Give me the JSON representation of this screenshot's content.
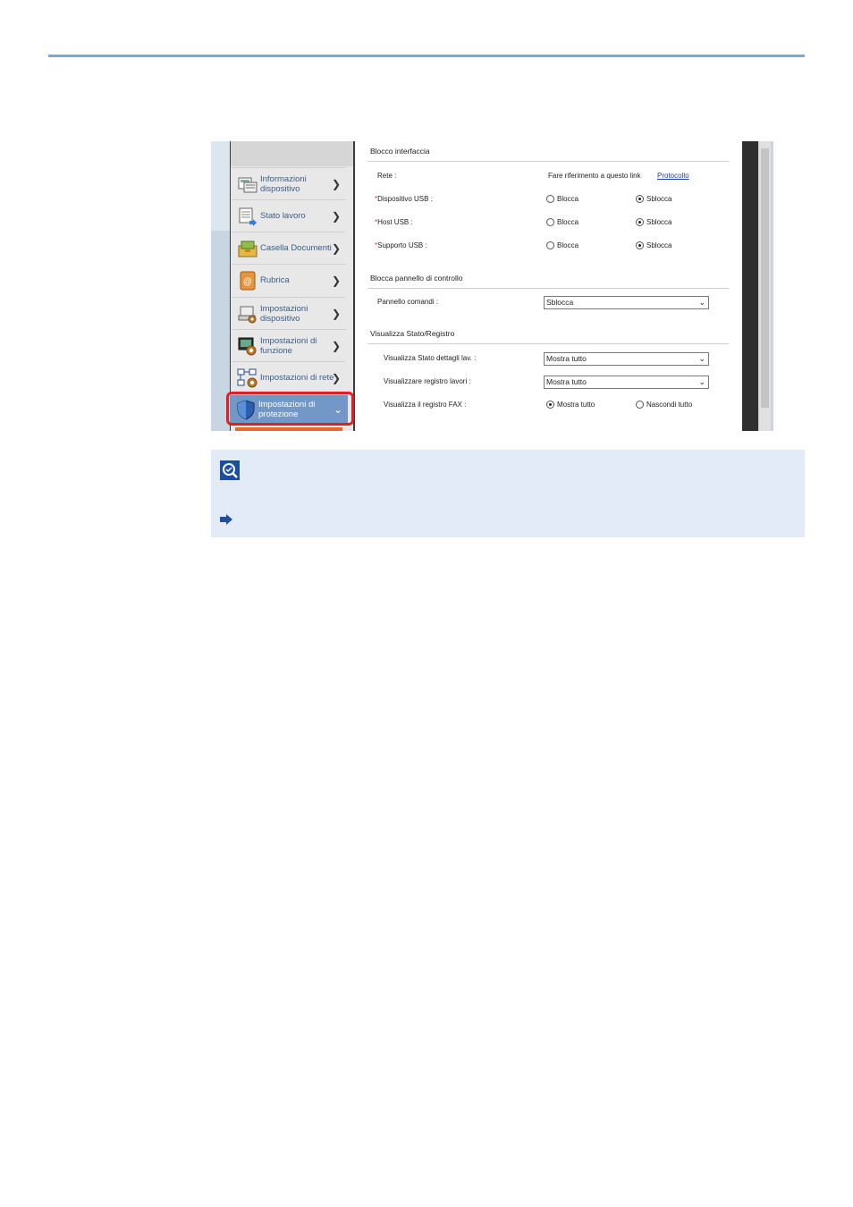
{
  "sidebar": {
    "items": [
      {
        "label": "Informazioni dispositivo",
        "icon": "device-info-icon"
      },
      {
        "label": "Stato lavoro",
        "icon": "job-status-icon"
      },
      {
        "label": "Casella Documenti",
        "icon": "document-box-icon"
      },
      {
        "label": "Rubrica",
        "icon": "address-book-icon"
      },
      {
        "label": "Impostazioni dispositivo",
        "icon": "device-settings-icon"
      },
      {
        "label": "Impostazioni di funzione",
        "icon": "function-settings-icon"
      },
      {
        "label": "Impostazioni di rete",
        "icon": "network-settings-icon"
      },
      {
        "label": "Impostazioni di protezione",
        "icon": "security-shield-icon",
        "active": true
      }
    ]
  },
  "interface_block": {
    "title": "Blocco interfaccia",
    "network": {
      "label": "Rete :",
      "text": "Fare riferimento a questo link",
      "link": "Protocollo"
    },
    "usb_device": {
      "label": "Dispositivo USB :",
      "options": [
        "Blocca",
        "Sblocca"
      ],
      "selected": "Sblocca"
    },
    "usb_host": {
      "label": "Host USB :",
      "options": [
        "Blocca",
        "Sblocca"
      ],
      "selected": "Sblocca"
    },
    "usb_storage": {
      "label": "Supporto USB :",
      "options": [
        "Blocca",
        "Sblocca"
      ],
      "selected": "Sblocca"
    }
  },
  "panel_lock": {
    "title": "Blocca pannello di controllo",
    "control_panel": {
      "label": "Pannello comandi :",
      "value": "Sblocca"
    }
  },
  "status_log": {
    "title": "Visualizza Stato/Registro",
    "job_detail": {
      "label": "Visualizza Stato dettagli lav. :",
      "value": "Mostra tutto"
    },
    "job_log": {
      "label": "Visualizzare registro lavori :",
      "value": "Mostra tutto"
    },
    "fax_log": {
      "label": "Visualizza il registro FAX :",
      "options": [
        "Mostra tutto",
        "Nascondi tutto"
      ],
      "selected": "Mostra tutto"
    }
  },
  "colors": {
    "accent": "#7397c6",
    "highlight": "#e11f22",
    "note_bg": "#e4ebf8",
    "rule": "#7aa6dc"
  },
  "note": {
    "icon": "note-icon",
    "arrow": "arrow-right-icon"
  }
}
